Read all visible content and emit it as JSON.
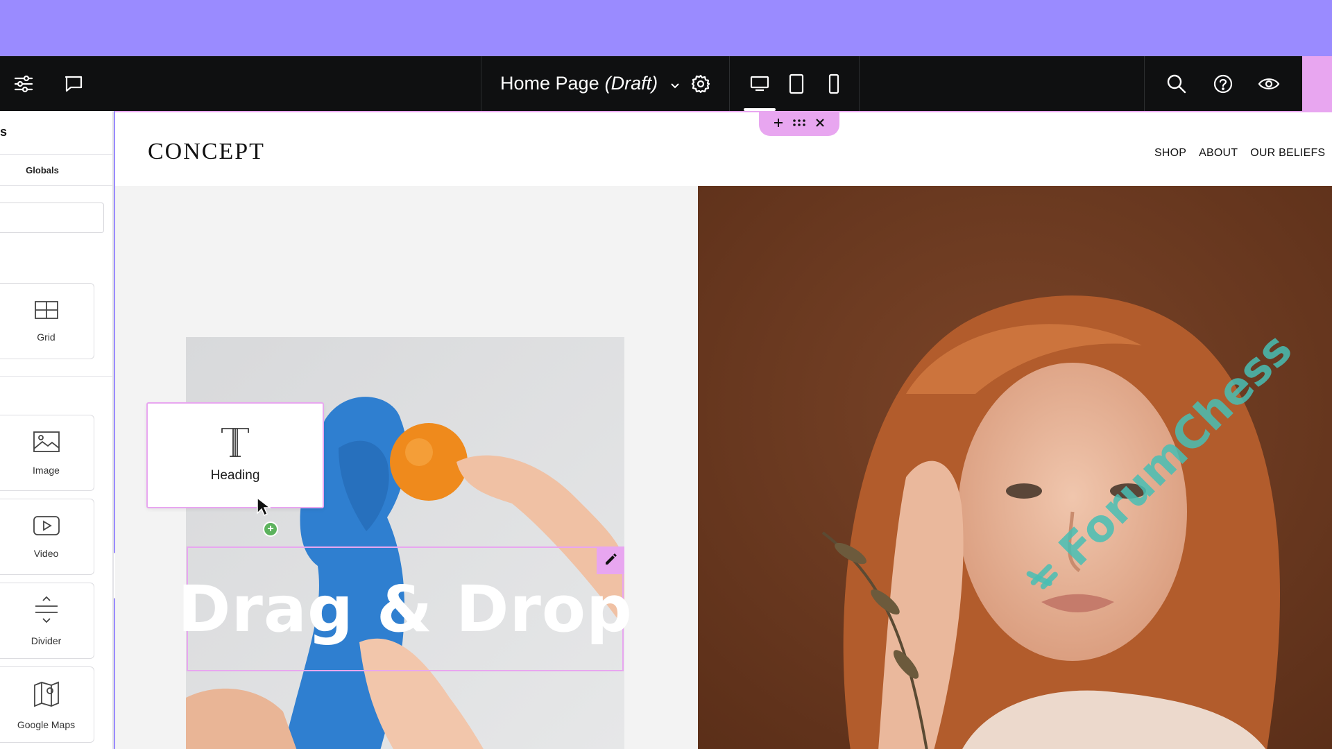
{
  "topbar": {
    "page_title": "Home Page",
    "page_status": "(Draft)"
  },
  "sidebar": {
    "title_fragment": "s",
    "tab_label": "Globals",
    "widgets": [
      {
        "label": "Grid",
        "icon": "grid-icon"
      },
      {
        "label": "Image",
        "icon": "image-icon"
      },
      {
        "label": "Video",
        "icon": "video-icon"
      },
      {
        "label": "Divider",
        "icon": "divider-icon"
      },
      {
        "label": "Google Maps",
        "icon": "map-icon"
      }
    ]
  },
  "site": {
    "logo": "CONCEPT",
    "nav": [
      "SHOP",
      "ABOUT",
      "OUR BELIEFS"
    ]
  },
  "canvas": {
    "heading_widget_label": "Heading",
    "headline_text": "Drag & Drop"
  },
  "watermark": {
    "text": "ForumChess"
  },
  "colors": {
    "banner": "#9a8bff",
    "topbar": "#0f1011",
    "selection": "#e8a6f0",
    "add_dot": "#5cb25d",
    "watermark": "#48beb4"
  }
}
